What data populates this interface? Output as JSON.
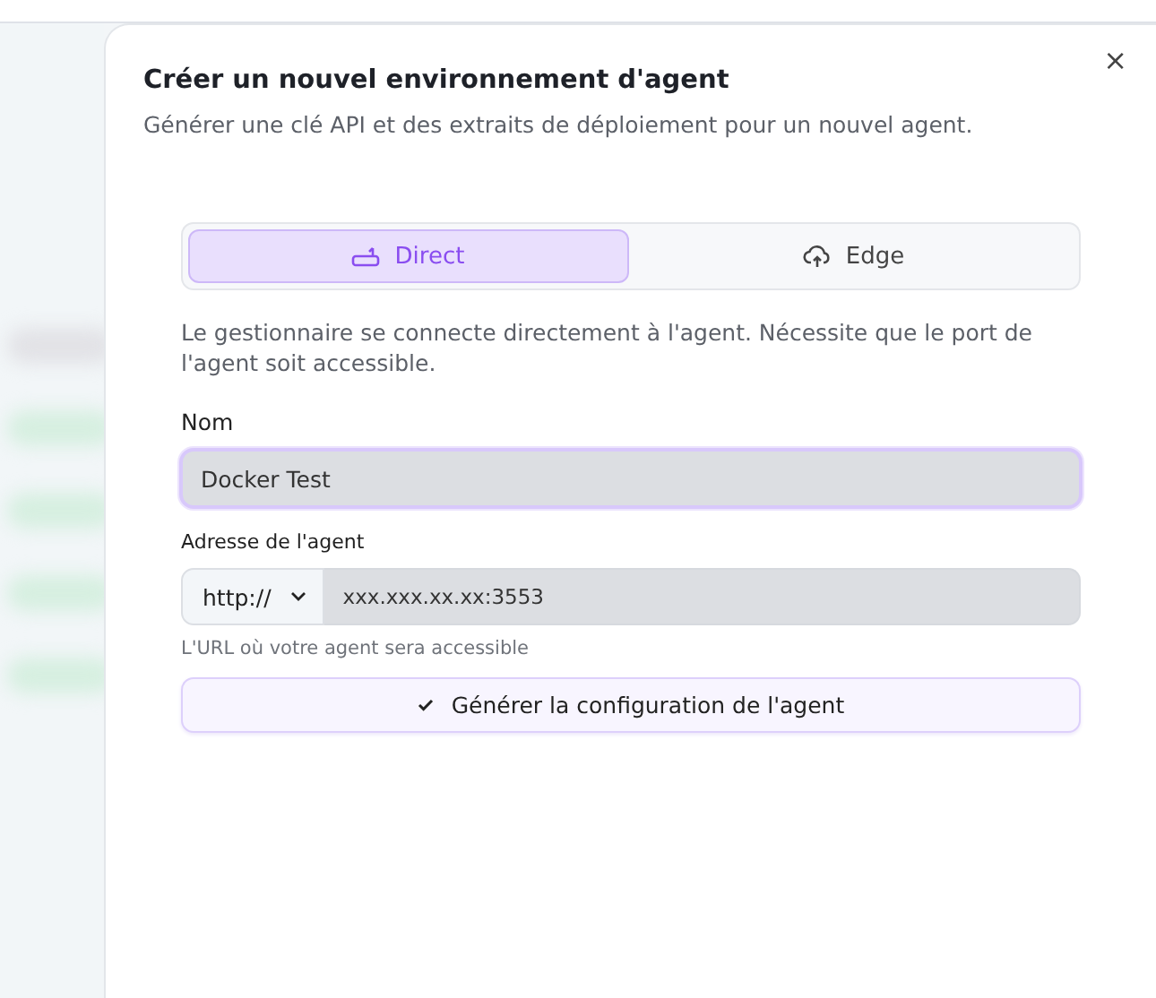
{
  "dialog": {
    "title": "Créer un nouvel environnement d'agent",
    "subtitle": "Générer une clé API et des extraits de déploiement pour un nouvel agent.",
    "close": "×"
  },
  "modes": [
    {
      "label": "Direct",
      "kind": "direct",
      "selected": true
    },
    {
      "label": "Edge",
      "kind": "edge",
      "selected": false
    }
  ],
  "description": "Le gestionnaire se connecte directement à l'agent. Nécessite que le port de l'agent soit accessible.",
  "name_field": {
    "label": "Nom",
    "value": "Docker Test",
    "focused": true
  },
  "address_field": {
    "label": "Adresse de l'agent",
    "protocol": "http://",
    "value": "xxx.xxx.xx.xx:3553",
    "hint": "L'URL où votre agent sera accessible"
  },
  "submit": {
    "label": "Générer la configuration de l'agent"
  }
}
